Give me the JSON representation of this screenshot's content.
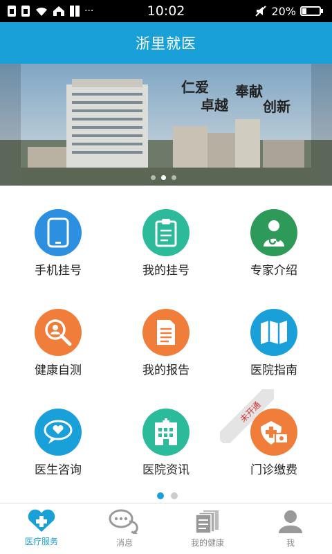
{
  "status_bar": {
    "time": "10:02",
    "battery": "20%",
    "more": "···"
  },
  "header": {
    "title": "浙里就医"
  },
  "banner": {
    "slogan": [
      "仁爱",
      "奉献",
      "卓越",
      "创新"
    ],
    "slide_count": 3,
    "active_slide": 2
  },
  "menu": {
    "items": [
      {
        "label": "手机挂号",
        "icon": "phone-icon",
        "color": "#2d8fe0"
      },
      {
        "label": "我的挂号",
        "icon": "clipboard-icon",
        "color": "#2bbb9a"
      },
      {
        "label": "专家介绍",
        "icon": "doctor-icon",
        "color": "#2e9a5a"
      },
      {
        "label": "健康自测",
        "icon": "search-person-icon",
        "color": "#f07d3a"
      },
      {
        "label": "我的报告",
        "icon": "report-icon",
        "color": "#f07d3a"
      },
      {
        "label": "医院指南",
        "icon": "map-icon",
        "color": "#1aa0d8"
      },
      {
        "label": "医生咨询",
        "icon": "chat-heart-icon",
        "color": "#1aa0d8"
      },
      {
        "label": "医院资讯",
        "icon": "hospital-icon",
        "color": "#2bbb9a"
      },
      {
        "label": "门诊缴费",
        "icon": "payment-icon",
        "color": "#f07d3a"
      }
    ],
    "not_open_label": "未开通",
    "page_count": 2,
    "active_page": 1
  },
  "tabs": [
    {
      "label": "医疗服务",
      "icon": "heart-plus-icon"
    },
    {
      "label": "消息",
      "icon": "message-icon"
    },
    {
      "label": "我的健康",
      "icon": "documents-icon"
    },
    {
      "label": "我",
      "icon": "person-icon"
    }
  ],
  "colors": {
    "primary": "#1aa0d8",
    "green": "#2bbb9a",
    "orange": "#f07d3a",
    "dark_green": "#2e9a5a"
  }
}
